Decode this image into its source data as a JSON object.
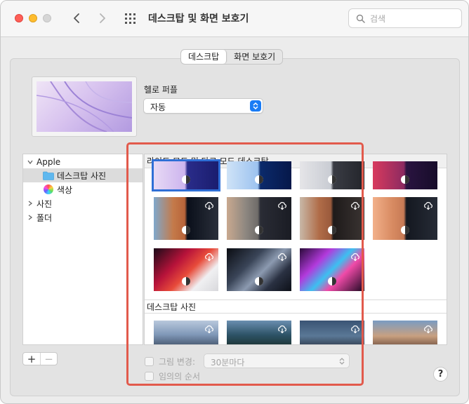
{
  "window": {
    "title": "데스크탑 및 화면 보호기",
    "search_placeholder": "검색"
  },
  "tabs": [
    {
      "label": "데스크탑",
      "active": true
    },
    {
      "label": "화면 보호기",
      "active": false
    }
  ],
  "wallpaper": {
    "name": "헬로 퍼플",
    "mode_value": "자동"
  },
  "sidebar": {
    "items": [
      {
        "label": "Apple",
        "expanded": true
      },
      {
        "label": "데스크탑 사진",
        "selected": true
      },
      {
        "label": "색상"
      },
      {
        "label": "사진",
        "expanded": false
      },
      {
        "label": "폴더",
        "expanded": false
      }
    ]
  },
  "grid": {
    "section1_title": "라이트 모드 및 다크 모드 데스크탑",
    "section2_title": "데스크탑 사진"
  },
  "controls": {
    "add_label": "+",
    "remove_label": "−",
    "change_picture_label": "그림 변경:",
    "interval_value": "30분마다",
    "random_order_label": "임의의 순서",
    "help_label": "?"
  },
  "colors": {
    "accent": "#1a7cf5",
    "annotation": "#e25a4c",
    "selection": "#2f6fd6"
  }
}
